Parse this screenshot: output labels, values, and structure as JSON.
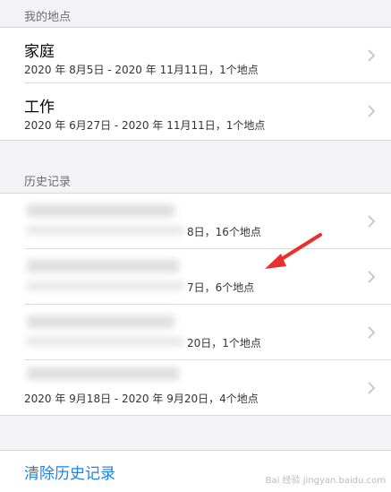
{
  "my_places": {
    "header": "我的地点",
    "items": [
      {
        "title": "家庭",
        "subtitle": "2020 年 8月5日 - 2020 年 11月11日，1个地点"
      },
      {
        "title": "工作",
        "subtitle": "2020 年 6月27日 - 2020 年 11月11日，1个地点"
      }
    ]
  },
  "history": {
    "header": "历史记录",
    "items": [
      {
        "subtitle_visible": "8日，16个地点"
      },
      {
        "subtitle_visible": "7日，6个地点"
      },
      {
        "subtitle_visible": "20日，1个地点"
      },
      {
        "subtitle_visible": "2020 年 9月18日 - 2020 年 9月20日，4个地点"
      }
    ]
  },
  "clear_history_label": "清除历史记录",
  "watermark": "Bai 经验 jingyan.baidu.com",
  "colors": {
    "accent": "#1a82f4",
    "annotation_arrow": "#e8312e",
    "background": "#f2f2f7"
  },
  "icons": {
    "chevron": "chevron-right-icon"
  }
}
